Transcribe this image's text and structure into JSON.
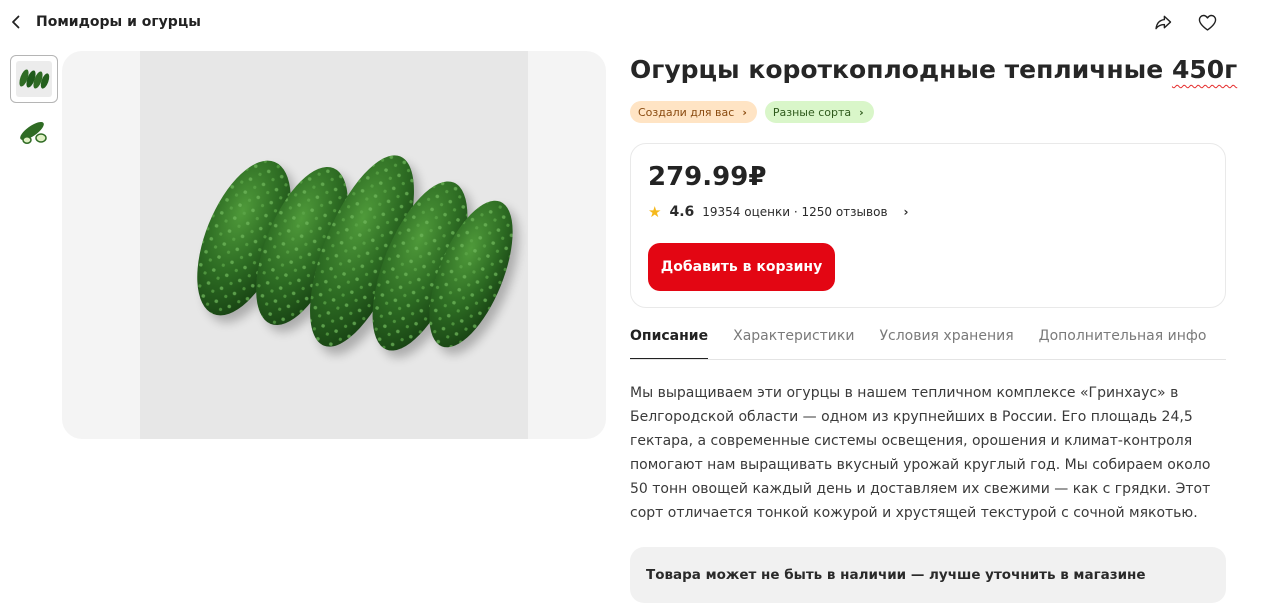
{
  "header": {
    "back_label": "Помидоры и огурцы"
  },
  "product": {
    "title": "Огурцы короткоплодные тепличные",
    "weight": "450г",
    "chips": [
      {
        "label": "Создали для вас",
        "color": "#ffe4c4"
      },
      {
        "label": "Разные сорта",
        "color": "#d9f6c9"
      }
    ],
    "price": "279.99₽",
    "rating": {
      "score": "4.6",
      "summary": "19354 оценки · 1250 отзывов"
    },
    "add_to_cart_label": "Добавить в корзину"
  },
  "tabs": [
    {
      "label": "Описание",
      "active": true
    },
    {
      "label": "Характеристики",
      "active": false
    },
    {
      "label": "Условия хранения",
      "active": false
    },
    {
      "label": "Дополнительная инфо",
      "active": false
    }
  ],
  "description": "Мы выращиваем эти огурцы в нашем тепличном комплексе «Гринхаус» в Белгородской области — одном из крупнейших в России. Его площадь 24,5 гектара, а современные системы освещения, орошения и климат-контроля помогают нам выращивать вкусный урожай круглый год. Мы собираем около 50 тонн овощей каждый день и доставляем их свежими — как с грядки. Этот сорт отличается тонкой кожурой и хрустящей текстурой с сочной мякотью.",
  "notice": "Товара может не быть в наличии — лучше уточнить в магазине",
  "icons": {
    "back": "chevron-left-icon",
    "share": "share-icon",
    "favorite": "heart-icon",
    "rating": "star-icon"
  },
  "colors": {
    "accent": "#e30613",
    "star": "#f5b81b",
    "cucumber": "#2f6b24"
  }
}
